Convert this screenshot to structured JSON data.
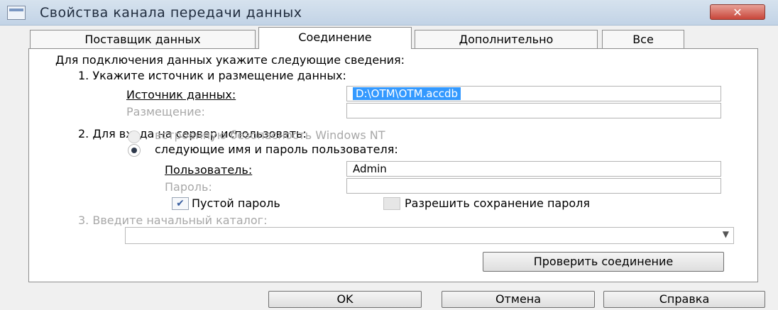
{
  "window": {
    "title": "Свойства канала передачи данных",
    "close_label": "✕"
  },
  "tabs": [
    {
      "label": "Поставщик данных"
    },
    {
      "label": "Соединение"
    },
    {
      "label": "Дополнительно"
    },
    {
      "label": "Все"
    }
  ],
  "form": {
    "intro": "Для подключения данных укажите следующие сведения:",
    "step1": "1. Укажите источник и размещение данных:",
    "datasource_label": "Источник данных:",
    "datasource_value": "D:\\OTM\\OTM.accdb",
    "location_label": "Размещение:",
    "location_value": "",
    "step2": "2. Для входа на сервер использовать:",
    "radio_windows": "встроенную безопасность Windows NT",
    "radio_user": "следующие имя и пароль пользователя:",
    "user_label": "Пользователь:",
    "user_value": "Admin",
    "password_label": "Пароль:",
    "password_value": "",
    "empty_password": "Пустой пароль",
    "allow_save": "Разрешить сохранение пароля",
    "step3": "3. Введите начальный каталог:",
    "catalog_value": "",
    "test_button": "Проверить соединение"
  },
  "buttons": {
    "ok": "OK",
    "cancel": "Отмена",
    "help": "Справка"
  }
}
